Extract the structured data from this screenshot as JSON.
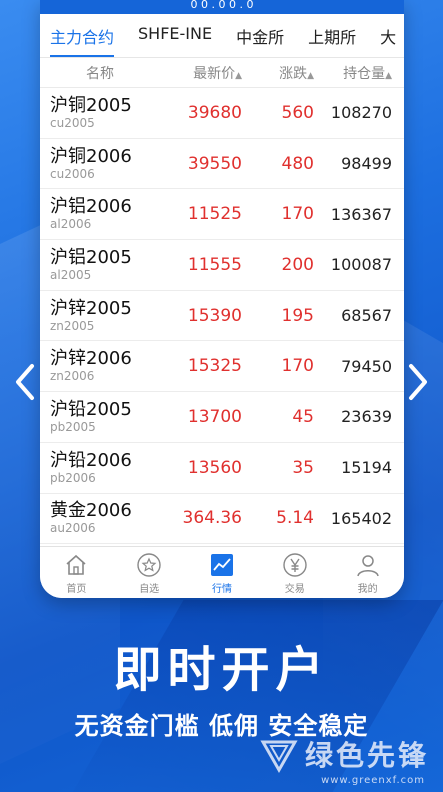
{
  "status_bar": {
    "text": "0 0 . 0 0 . 0"
  },
  "tabs": [
    {
      "label": "主力合约",
      "active": true
    },
    {
      "label": "SHFE-INE",
      "active": false
    },
    {
      "label": "中金所",
      "active": false
    },
    {
      "label": "上期所",
      "active": false
    }
  ],
  "tab_more": "大",
  "header": {
    "name": "名称",
    "price": "最新价",
    "change": "涨跌",
    "oi": "持仓量",
    "sort_icon": "▲"
  },
  "rows": [
    {
      "name": "沪铜2005",
      "code": "cu2005",
      "price": "39680",
      "change": "560",
      "oi": "108270"
    },
    {
      "name": "沪铜2006",
      "code": "cu2006",
      "price": "39550",
      "change": "480",
      "oi": "98499"
    },
    {
      "name": "沪铝2006",
      "code": "al2006",
      "price": "11525",
      "change": "170",
      "oi": "136367"
    },
    {
      "name": "沪铝2005",
      "code": "al2005",
      "price": "11555",
      "change": "200",
      "oi": "100087"
    },
    {
      "name": "沪锌2005",
      "code": "zn2005",
      "price": "15390",
      "change": "195",
      "oi": "68567"
    },
    {
      "name": "沪锌2006",
      "code": "zn2006",
      "price": "15325",
      "change": "170",
      "oi": "79450"
    },
    {
      "name": "沪铅2005",
      "code": "pb2005",
      "price": "13700",
      "change": "45",
      "oi": "23639"
    },
    {
      "name": "沪铅2006",
      "code": "pb2006",
      "price": "13560",
      "change": "35",
      "oi": "15194"
    },
    {
      "name": "黄金2006",
      "code": "au2006",
      "price": "364.36",
      "change": "5.14",
      "oi": "165402"
    }
  ],
  "nav": [
    {
      "label": "首页",
      "icon": "home-icon"
    },
    {
      "label": "自选",
      "icon": "star-icon"
    },
    {
      "label": "行情",
      "icon": "chart-icon",
      "active": true
    },
    {
      "label": "交易",
      "icon": "yen-icon"
    },
    {
      "label": "我的",
      "icon": "user-icon"
    }
  ],
  "promo": {
    "headline": "即时开户",
    "subline": "无资金门槛 低佣 安全稳定"
  },
  "watermark": {
    "name": "绿色先锋",
    "url": "www.greenxf.com"
  },
  "colors": {
    "accent": "#1a73e8",
    "up": "#e0302e",
    "background": "#1d6fe0"
  }
}
